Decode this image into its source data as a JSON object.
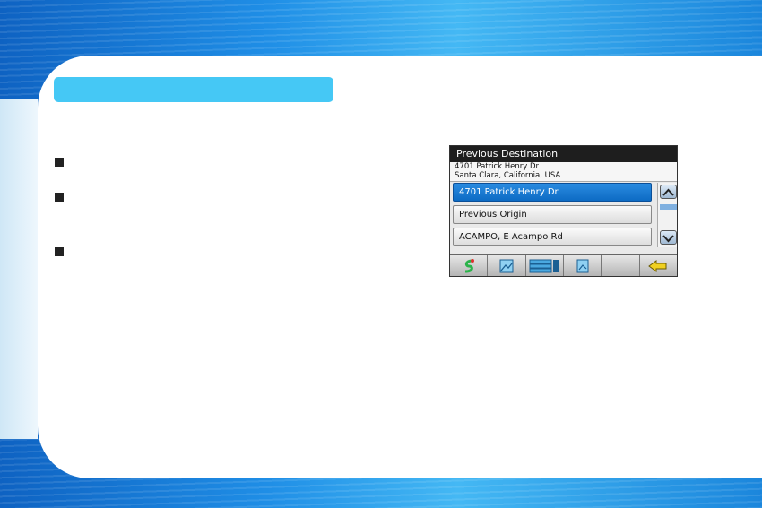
{
  "section_header": "",
  "bullets": [
    "",
    "",
    ""
  ],
  "device": {
    "title": "Previous Destination",
    "address": {
      "line1": "4701 Patrick Henry Dr",
      "line2": "Santa Clara, California, USA"
    },
    "list": [
      {
        "label": "4701 Patrick Henry Dr",
        "selected": true
      },
      {
        "label": "Previous Origin",
        "selected": false
      },
      {
        "label": "ACAMPO, E Acampo Rd",
        "selected": false
      }
    ],
    "toolbar": [
      "route-icon",
      "map-icon",
      "list-icon",
      "doc-icon",
      "blank",
      "back-arrow-icon"
    ],
    "colors": {
      "selected": "#0d6bc4",
      "titlebar": "#1e1e1e",
      "header": "#45c8f5"
    }
  }
}
